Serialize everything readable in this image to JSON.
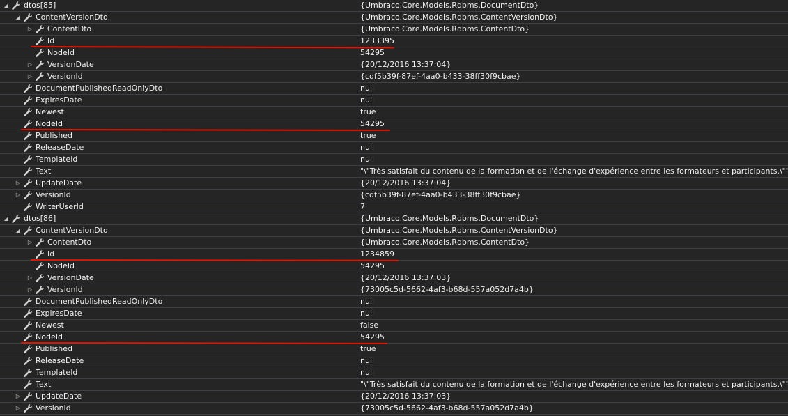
{
  "colors": {
    "background": "#252526",
    "grid_line": "#3f3f46",
    "text": "#f1f1f1",
    "highlight": "#e51400"
  },
  "icons": {
    "expanded": "triangle-down-icon",
    "collapsed": "triangle-right-icon",
    "property": "wrench-icon"
  },
  "rows": [
    {
      "name": "dtos[85]",
      "value": "{Umbraco.Core.Models.Rdbms.DocumentDto}",
      "level": 0,
      "expander": "expanded"
    },
    {
      "name": "ContentVersionDto",
      "value": "{Umbraco.Core.Models.Rdbms.ContentVersionDto}",
      "level": 1,
      "expander": "expanded"
    },
    {
      "name": "ContentDto",
      "value": "{Umbraco.Core.Models.Rdbms.ContentDto}",
      "level": 2,
      "expander": "collapsed"
    },
    {
      "name": "Id",
      "value": "1233395",
      "level": 2,
      "expander": "none"
    },
    {
      "name": "NodeId",
      "value": "54295",
      "level": 2,
      "expander": "none"
    },
    {
      "name": "VersionDate",
      "value": "{20/12/2016 13:37:04}",
      "level": 2,
      "expander": "collapsed"
    },
    {
      "name": "VersionId",
      "value": "{cdf5b39f-87ef-4aa0-b433-38ff30f9cbae}",
      "level": 2,
      "expander": "collapsed"
    },
    {
      "name": "DocumentPublishedReadOnlyDto",
      "value": "null",
      "level": 1,
      "expander": "none"
    },
    {
      "name": "ExpiresDate",
      "value": "null",
      "level": 1,
      "expander": "none"
    },
    {
      "name": "Newest",
      "value": "true",
      "level": 1,
      "expander": "none"
    },
    {
      "name": "NodeId",
      "value": "54295",
      "level": 1,
      "expander": "none"
    },
    {
      "name": "Published",
      "value": "true",
      "level": 1,
      "expander": "none"
    },
    {
      "name": "ReleaseDate",
      "value": "null",
      "level": 1,
      "expander": "none"
    },
    {
      "name": "TemplateId",
      "value": "null",
      "level": 1,
      "expander": "none"
    },
    {
      "name": "Text",
      "value": "\"\\\"Très satisfait du contenu de la formation et de l'échange d'expérience entre les formateurs et participants.\\\"\"",
      "level": 1,
      "expander": "none"
    },
    {
      "name": "UpdateDate",
      "value": "{20/12/2016 13:37:04}",
      "level": 1,
      "expander": "collapsed"
    },
    {
      "name": "VersionId",
      "value": "{cdf5b39f-87ef-4aa0-b433-38ff30f9cbae}",
      "level": 1,
      "expander": "collapsed"
    },
    {
      "name": "WriterUserId",
      "value": "7",
      "level": 1,
      "expander": "none"
    },
    {
      "name": "dtos[86]",
      "value": "{Umbraco.Core.Models.Rdbms.DocumentDto}",
      "level": 0,
      "expander": "expanded"
    },
    {
      "name": "ContentVersionDto",
      "value": "{Umbraco.Core.Models.Rdbms.ContentVersionDto}",
      "level": 1,
      "expander": "expanded"
    },
    {
      "name": "ContentDto",
      "value": "{Umbraco.Core.Models.Rdbms.ContentDto}",
      "level": 2,
      "expander": "collapsed"
    },
    {
      "name": "Id",
      "value": "1234859",
      "level": 2,
      "expander": "none"
    },
    {
      "name": "NodeId",
      "value": "54295",
      "level": 2,
      "expander": "none"
    },
    {
      "name": "VersionDate",
      "value": "{20/12/2016 13:37:03}",
      "level": 2,
      "expander": "collapsed"
    },
    {
      "name": "VersionId",
      "value": "{73005c5d-5662-4af3-b68d-557a052d7a4b}",
      "level": 2,
      "expander": "collapsed"
    },
    {
      "name": "DocumentPublishedReadOnlyDto",
      "value": "null",
      "level": 1,
      "expander": "none"
    },
    {
      "name": "ExpiresDate",
      "value": "null",
      "level": 1,
      "expander": "none"
    },
    {
      "name": "Newest",
      "value": "false",
      "level": 1,
      "expander": "none"
    },
    {
      "name": "NodeId",
      "value": "54295",
      "level": 1,
      "expander": "none"
    },
    {
      "name": "Published",
      "value": "true",
      "level": 1,
      "expander": "none"
    },
    {
      "name": "ReleaseDate",
      "value": "null",
      "level": 1,
      "expander": "none"
    },
    {
      "name": "TemplateId",
      "value": "null",
      "level": 1,
      "expander": "none"
    },
    {
      "name": "Text",
      "value": "\"\\\"Très satisfait du contenu de la formation et de l'échange d'expérience entre les formateurs et participants.\\\"\"",
      "level": 1,
      "expander": "none"
    },
    {
      "name": "UpdateDate",
      "value": "{20/12/2016 13:37:03}",
      "level": 1,
      "expander": "collapsed"
    },
    {
      "name": "VersionId",
      "value": "{73005c5d-5662-4af3-b68d-557a052d7a4b}",
      "level": 1,
      "expander": "collapsed"
    }
  ],
  "highlighted_rows": [
    3,
    10,
    21,
    28
  ]
}
